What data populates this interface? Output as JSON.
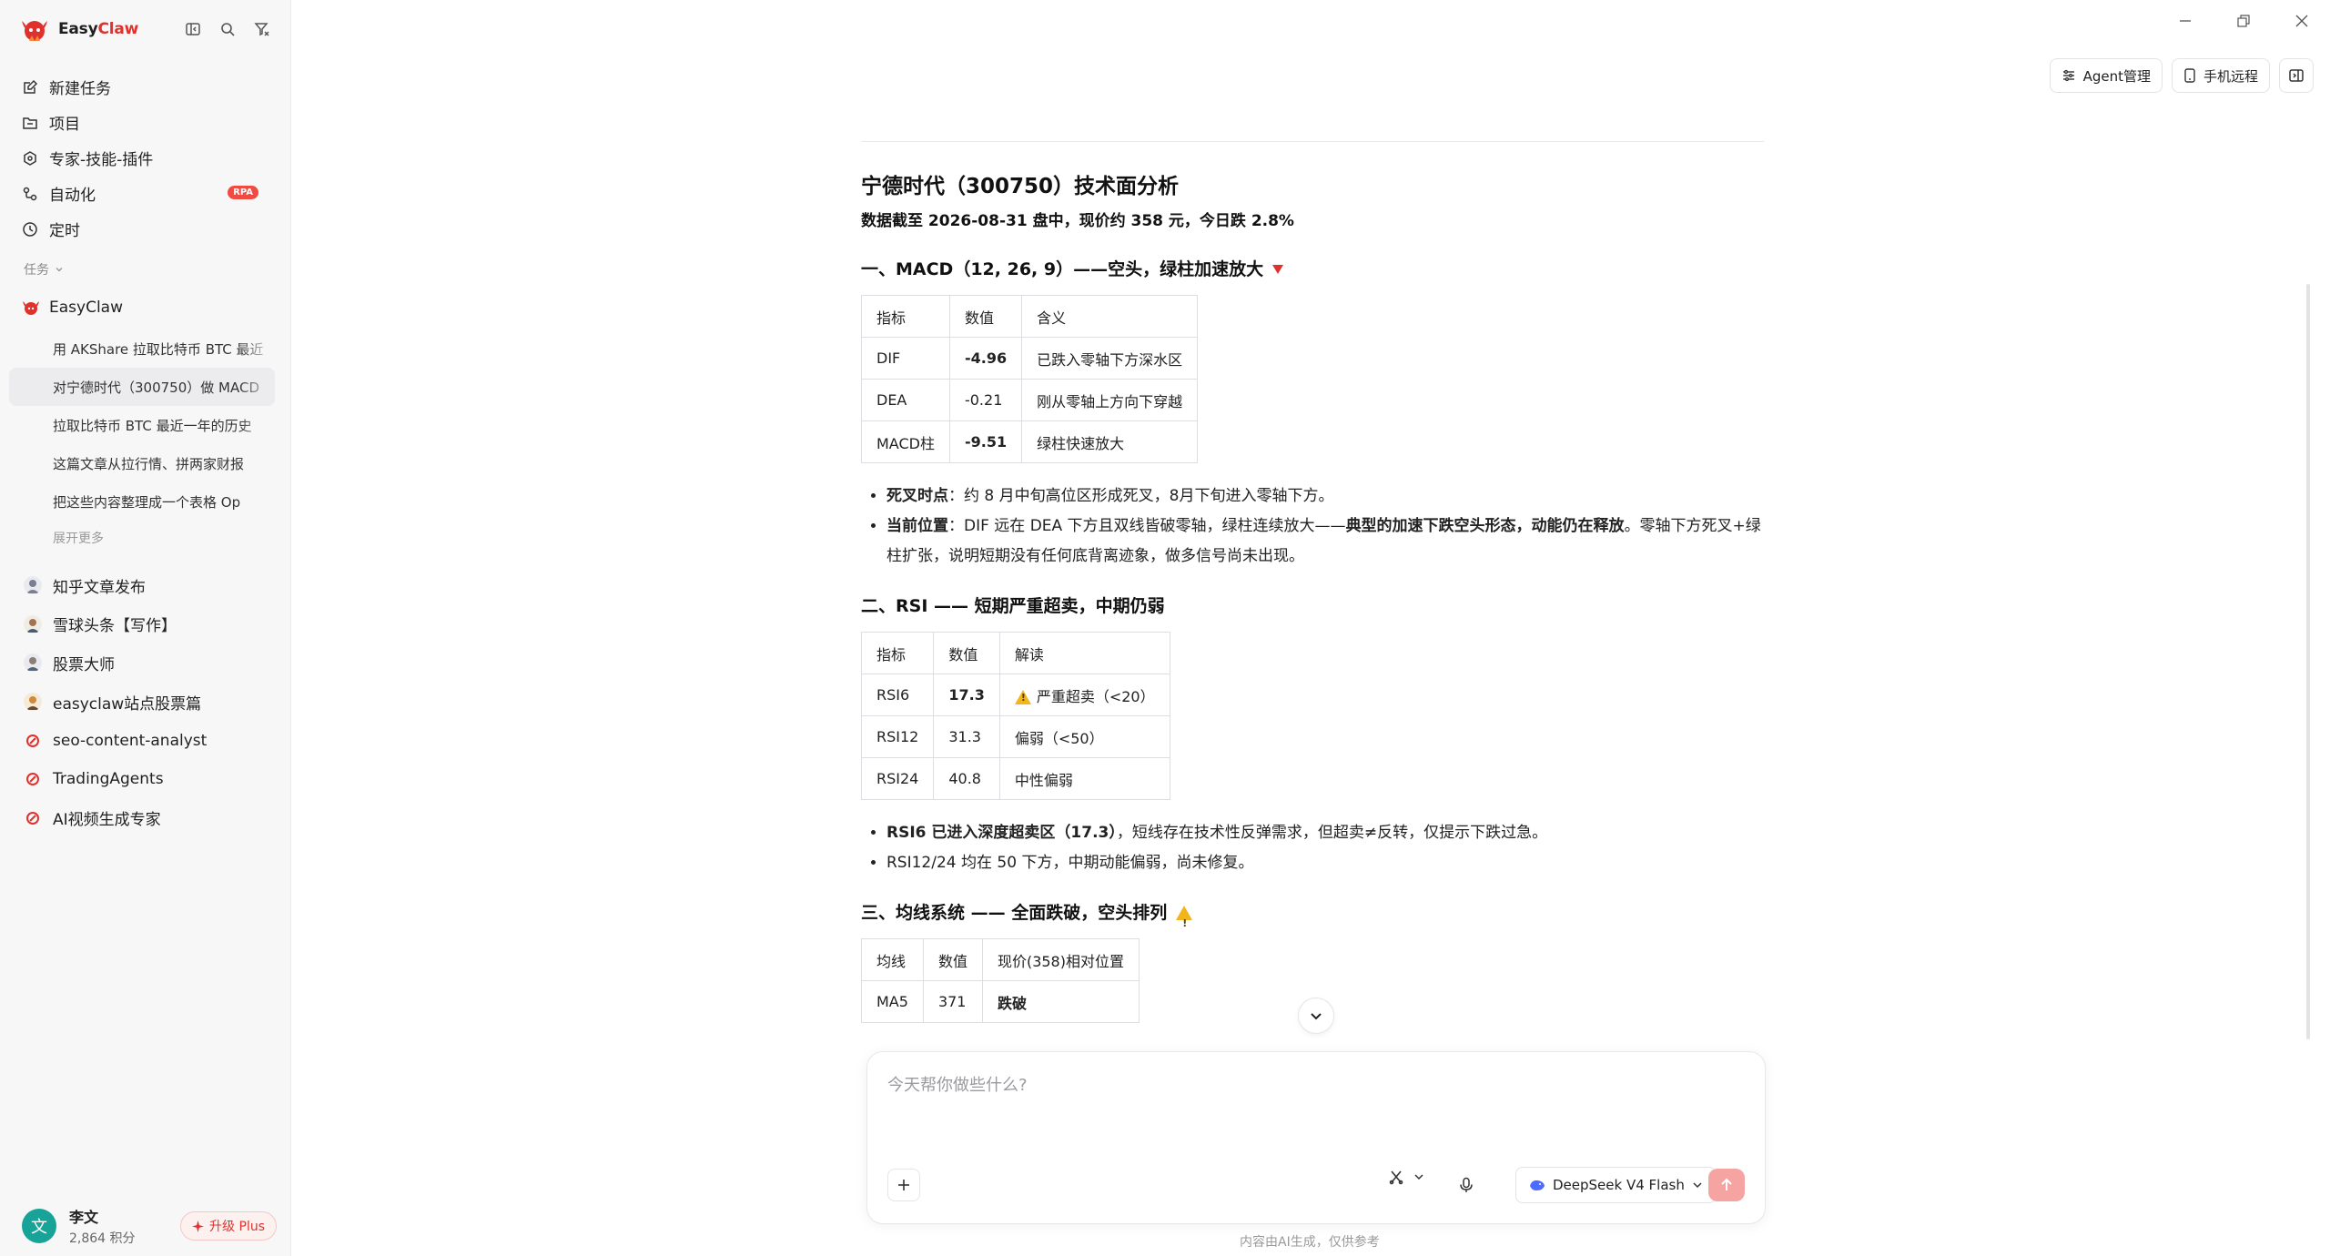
{
  "app": {
    "brand_part1": "Easy",
    "brand_part2": "Claw"
  },
  "sidebar": {
    "nav": [
      {
        "label": "新建任务",
        "icon": "new-task-icon"
      },
      {
        "label": "项目",
        "icon": "folder-icon"
      },
      {
        "label": "专家-技能-插件",
        "icon": "puzzle-icon"
      },
      {
        "label": "自动化",
        "icon": "automation-icon",
        "badge": "RPA"
      },
      {
        "label": "定时",
        "icon": "clock-icon"
      }
    ],
    "section_label": "任务",
    "group_name": "EasyClaw",
    "tasks": [
      "用 AKShare 拉取比特币 BTC 最近",
      "对宁德时代（300750）做 MACD",
      "拉取比特币 BTC 最近一年的历史",
      "这篇文章从拉行情、拼两家财报",
      "把这些内容整理成一个表格 Op"
    ],
    "expand_more": "展开更多",
    "agents": [
      "知乎文章发布",
      "雪球头条【写作】",
      "股票大师",
      "easyclaw站点股票篇",
      "seo-content-analyst",
      "TradingAgents",
      "AI视频生成专家"
    ],
    "user": {
      "avatar_text": "文",
      "name": "李文",
      "points": "2,864 积分",
      "upgrade": "升级 Plus"
    }
  },
  "header": {
    "agent_manage": "Agent管理",
    "phone_remote": "手机远程"
  },
  "doc": {
    "title": "宁德时代（300750）技术面分析",
    "subtitle": "数据截至 2026-08-31 盘中，现价约 358 元，今日跌 2.8%",
    "macd": {
      "heading": "一、MACD（12, 26, 9）——空头，绿柱加速放大",
      "headers": [
        "指标",
        "数值",
        "含义"
      ],
      "rows": [
        [
          "DIF",
          "-4.96",
          "已跌入零轴下方深水区"
        ],
        [
          "DEA",
          "-0.21",
          "刚从零轴上方向下穿越"
        ],
        [
          "MACD柱",
          "-9.51",
          "绿柱快速放大"
        ]
      ],
      "bullet1_label": "死叉时点",
      "bullet1_text": "：约 8 月中旬高位区形成死叉，8月下旬进入零轴下方。",
      "bullet2_label": "当前位置",
      "bullet2_text1": "：DIF 远在 DEA 下方且双线皆破零轴，绿柱连续放大——",
      "bullet2_strong": "典型的加速下跌空头形态，动能仍在释放",
      "bullet2_text2": "。零轴下方死叉+绿柱扩张，说明短期没有任何底背离迹象，做多信号尚未出现。"
    },
    "rsi": {
      "heading": "二、RSI —— 短期严重超卖，中期仍弱",
      "headers": [
        "指标",
        "数值",
        "解读"
      ],
      "rows": [
        [
          "RSI6",
          "17.3",
          "严重超卖（<20）"
        ],
        [
          "RSI12",
          "31.3",
          "偏弱（<50）"
        ],
        [
          "RSI24",
          "40.8",
          "中性偏弱"
        ]
      ],
      "bullet1_strong": "RSI6 已进入深度超卖区（17.3）",
      "bullet1_text": "，短线存在技术性反弹需求，但超卖≠反转，仅提示下跌过急。",
      "bullet2_text": "RSI12/24 均在 50 下方，中期动能偏弱，尚未修复。"
    },
    "ma": {
      "heading": "三、均线系统 —— 全面跌破，空头排列",
      "headers": [
        "均线",
        "数值",
        "现价(358)相对位置"
      ],
      "rows": [
        [
          "MA5",
          "371",
          "跌破"
        ]
      ]
    }
  },
  "composer": {
    "placeholder": "今天帮你做些什么?",
    "model": "DeepSeek V4 Flash",
    "disclaimer": "内容由AI生成，仅供参考"
  },
  "colors": {
    "accent": "#e0322d",
    "send_disabled": "#f5a4a1",
    "user_avatar": "#17a398"
  }
}
